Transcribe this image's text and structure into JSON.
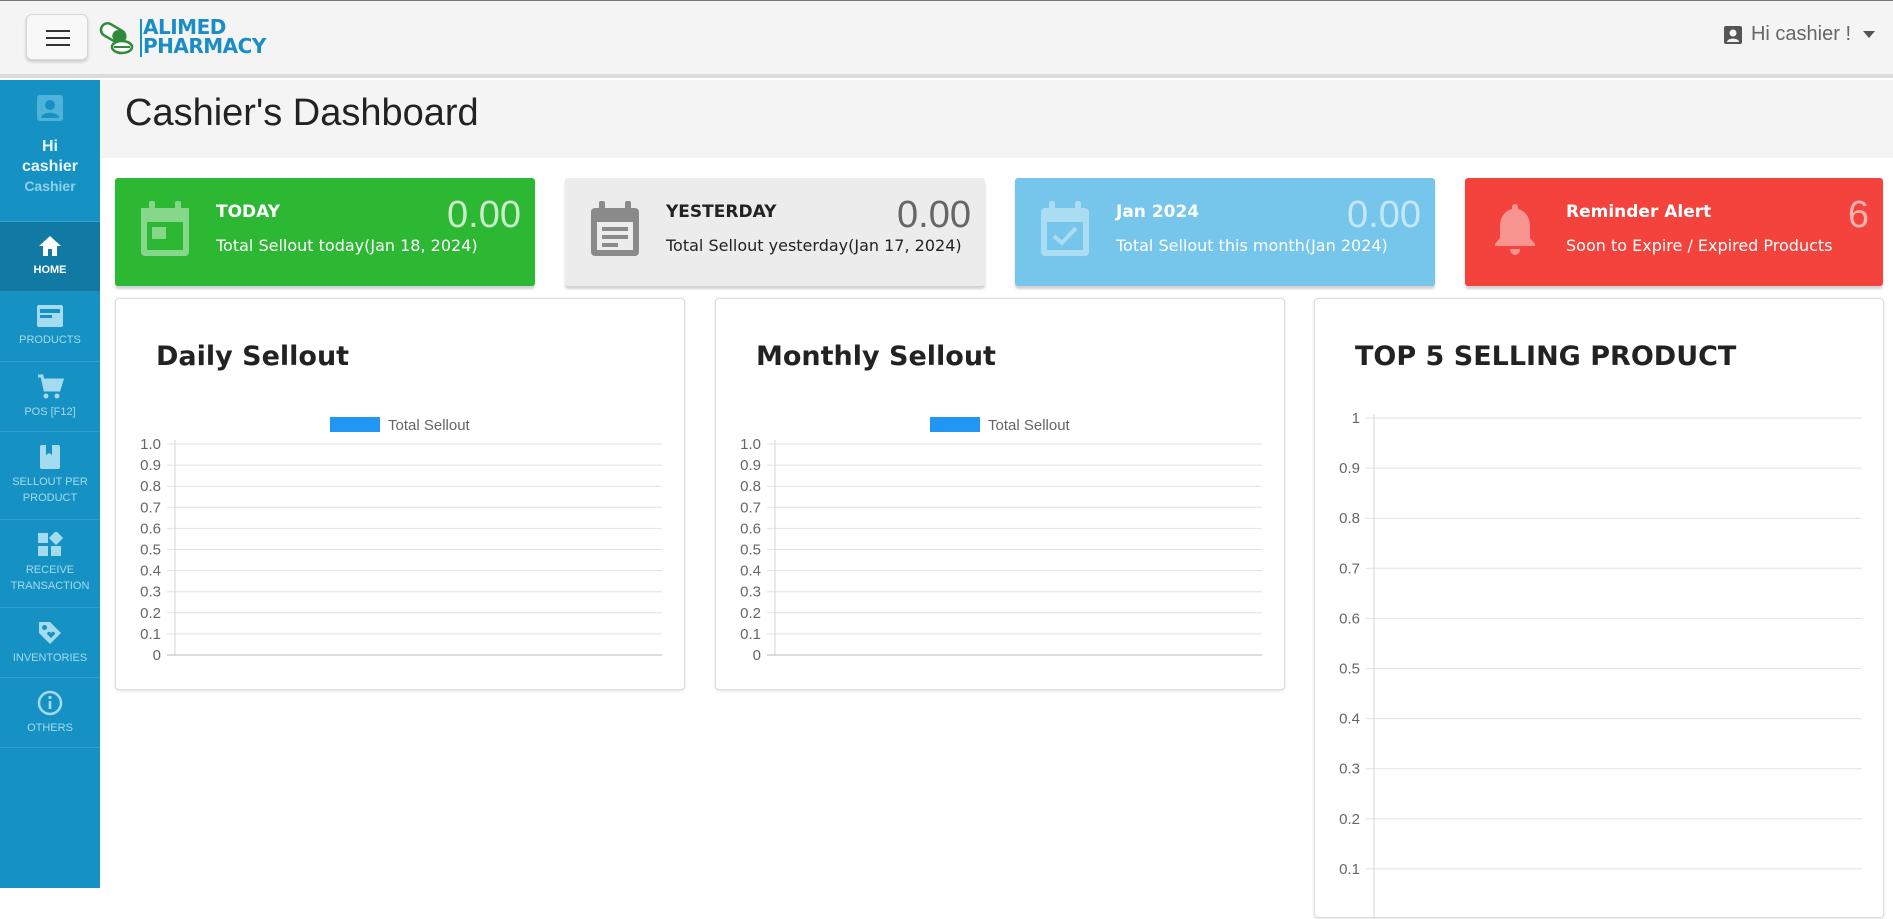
{
  "brand": {
    "line1": "ALIMED",
    "line2": "PHARMACY"
  },
  "user_menu": {
    "label": "Hi cashier !"
  },
  "sidebar": {
    "greeting_hi": "Hi",
    "greeting_name": "cashier",
    "role": "Cashier",
    "items": [
      {
        "label": "HOME",
        "icon": "home-icon"
      },
      {
        "label": "PRODUCTS",
        "icon": "products-icon"
      },
      {
        "label": "POS [F12]",
        "icon": "cart-icon"
      },
      {
        "label_line1": "SELLOUT PER",
        "label_line2": "PRODUCT",
        "icon": "book-icon"
      },
      {
        "label_line1": "RECEIVE",
        "label_line2": "TRANSACTION",
        "icon": "widgets-icon"
      },
      {
        "label": "INVENTORIES",
        "icon": "tag-icon"
      },
      {
        "label": "OTHERS",
        "icon": "info-icon"
      }
    ]
  },
  "page": {
    "title": "Cashier's Dashboard"
  },
  "info_boxes": [
    {
      "label": "TODAY",
      "desc": "Total Sellout today(Jan 18, 2024)",
      "value": "0.00",
      "color": "#2db834"
    },
    {
      "label": "YESTERDAY",
      "desc": "Total Sellout yesterday(Jan 17, 2024)",
      "value": "0.00",
      "color": "#ececec"
    },
    {
      "label": "Jan 2024",
      "desc": "Total Sellout this month(Jan 2024)",
      "value": "0.00",
      "color": "#75c6ea"
    },
    {
      "label": "Reminder Alert",
      "desc": "Soon to Expire / Expired Products",
      "value": "6",
      "color": "#f4433c"
    }
  ],
  "cards": {
    "daily": {
      "title": "Daily Sellout"
    },
    "monthly": {
      "title": "Monthly Sellout"
    },
    "top5": {
      "title": "TOP 5 SELLING PRODUCT"
    }
  },
  "chart_data": [
    {
      "type": "bar",
      "legend": [
        "Total Sellout"
      ],
      "series": [
        {
          "name": "Total Sellout",
          "values": []
        }
      ],
      "yticks": [
        "1.0",
        "0.9",
        "0.8",
        "0.7",
        "0.6",
        "0.5",
        "0.4",
        "0.3",
        "0.2",
        "0.1",
        "0"
      ],
      "ylim": [
        0,
        1
      ],
      "grid": true,
      "legend_position": "top",
      "color": "#2196f3"
    },
    {
      "type": "bar",
      "legend": [
        "Total Sellout"
      ],
      "series": [
        {
          "name": "Total Sellout",
          "values": []
        }
      ],
      "yticks": [
        "1.0",
        "0.9",
        "0.8",
        "0.7",
        "0.6",
        "0.5",
        "0.4",
        "0.3",
        "0.2",
        "0.1",
        "0"
      ],
      "ylim": [
        0,
        1
      ],
      "grid": true,
      "legend_position": "top",
      "color": "#2196f3"
    },
    {
      "type": "bar",
      "series": [],
      "yticks": [
        "1",
        "0.9",
        "0.8",
        "0.7",
        "0.6",
        "0.5",
        "0.4",
        "0.3",
        "0.2",
        "0.1"
      ],
      "ylim": [
        0,
        1
      ],
      "grid": true
    }
  ]
}
